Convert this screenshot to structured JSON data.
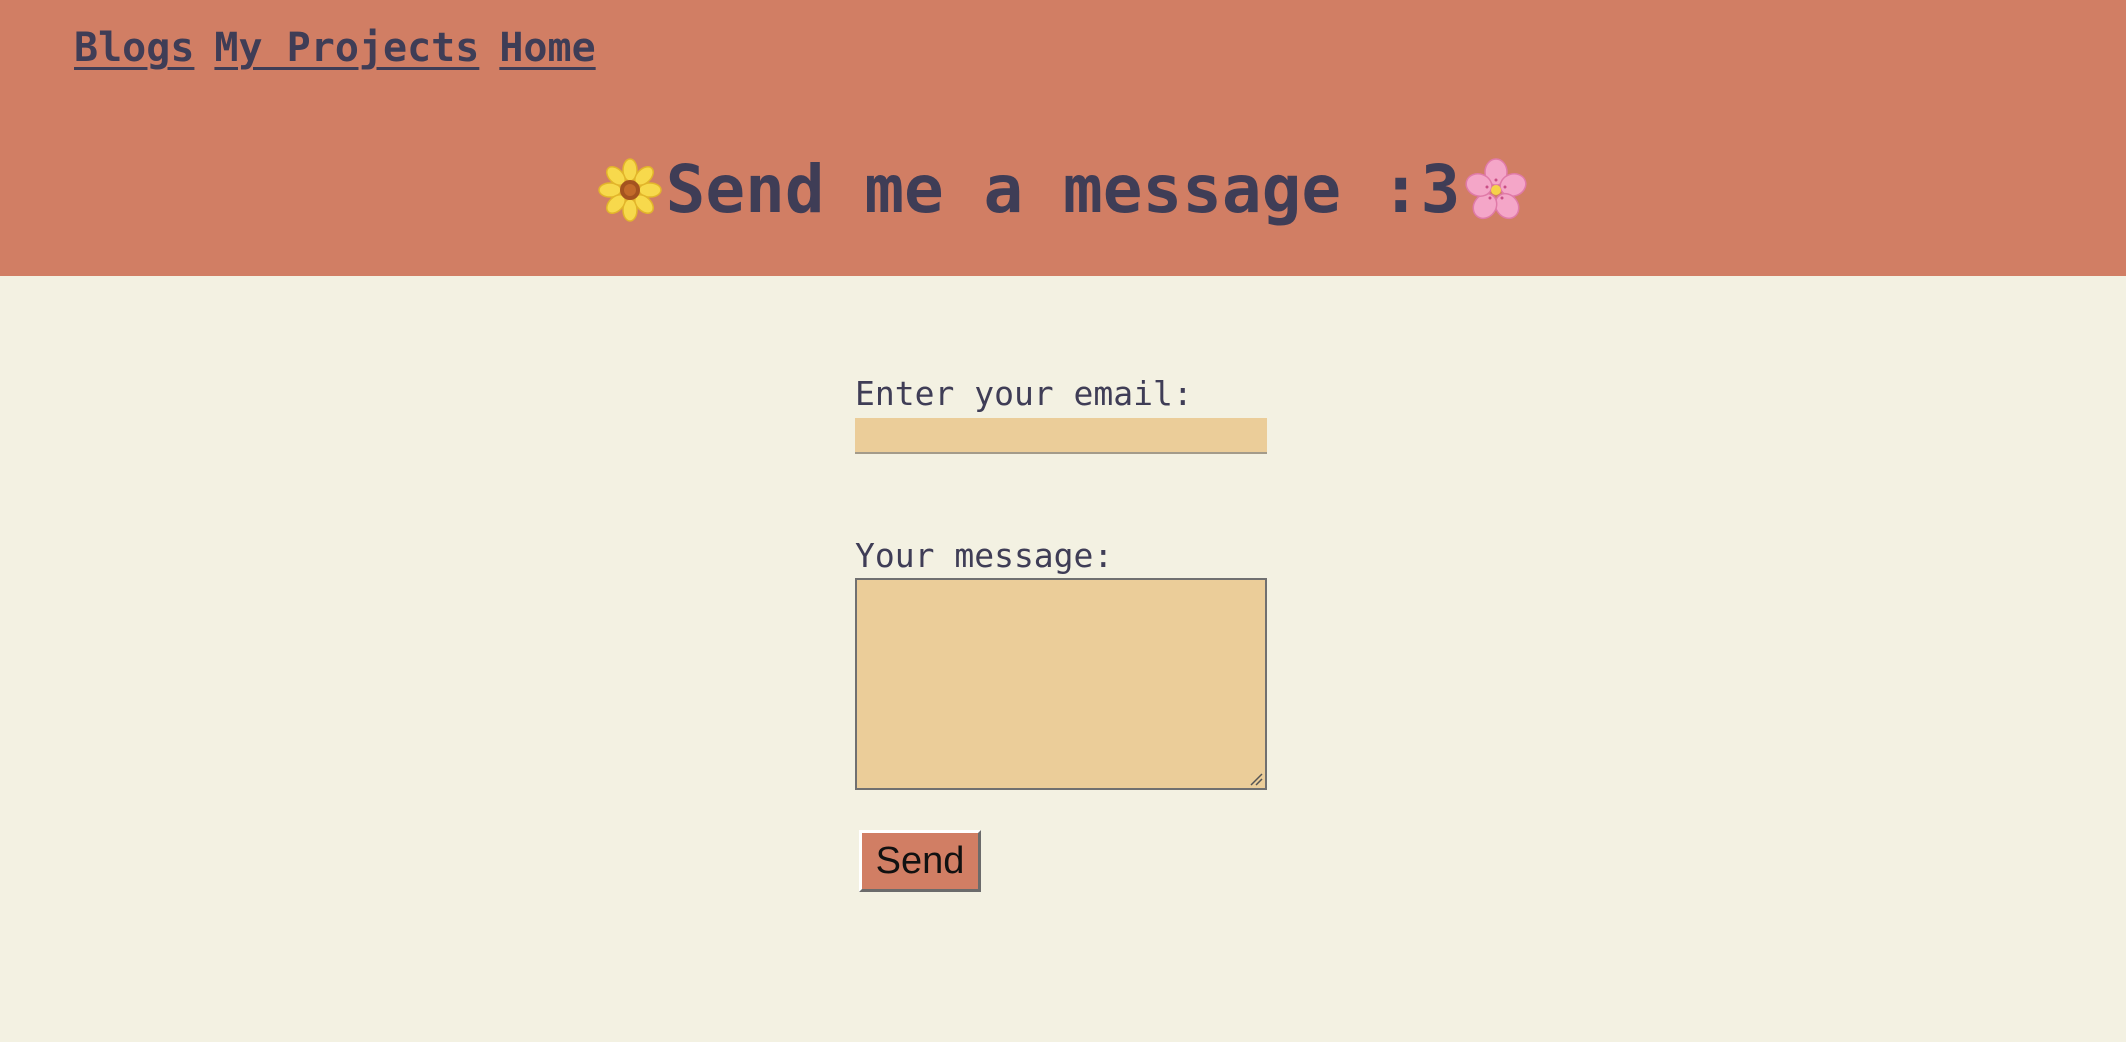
{
  "nav": {
    "links": [
      {
        "label": "Blogs"
      },
      {
        "label": "My Projects"
      },
      {
        "label": "Home"
      }
    ]
  },
  "header": {
    "title": "Send me a message :3",
    "left_icon": "sunflower-icon",
    "right_icon": "cherry-blossom-icon"
  },
  "form": {
    "email_label": "Enter your email:",
    "email_value": "",
    "message_label": "Your message:",
    "message_value": "",
    "send_label": "Send"
  },
  "colors": {
    "header_bg": "#d17e64",
    "page_bg": "#f3f1e2",
    "text": "#3f3d56",
    "input_bg": "#ebcd99",
    "button_bg": "#d17e64"
  }
}
